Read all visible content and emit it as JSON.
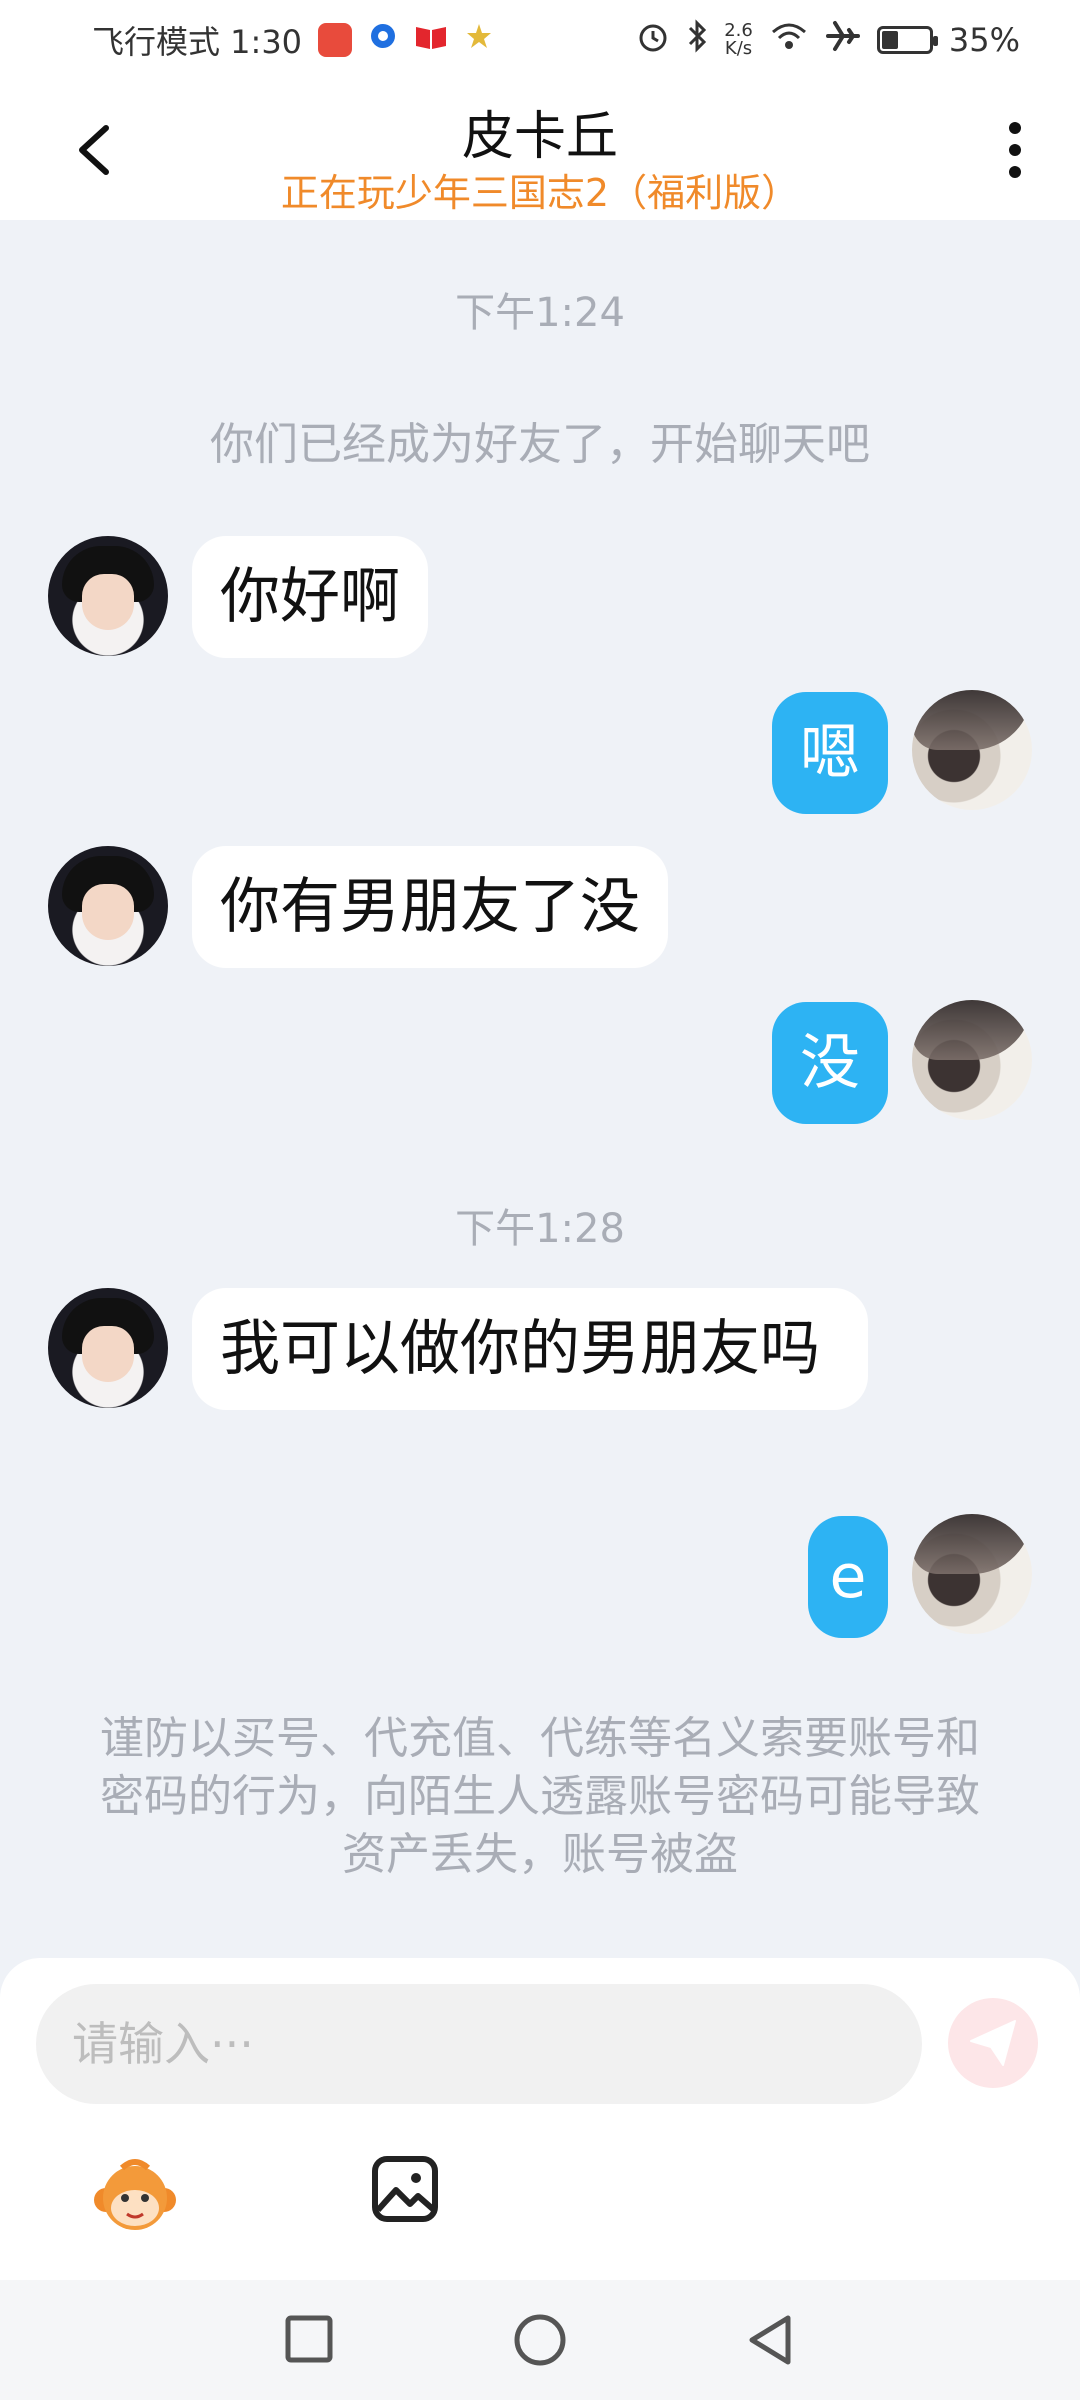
{
  "status_bar": {
    "left_text": "飞行模式 1:30",
    "speed_value": "2.6",
    "speed_unit": "K/s",
    "battery_text": "35%",
    "battery_level": 0.35
  },
  "header": {
    "title": "皮卡丘",
    "subtitle": "正在玩少年三国志2（福利版）"
  },
  "chat": {
    "timestamps": [
      "下午1:24",
      "下午1:28"
    ],
    "system_message": "你们已经成为好友了，开始聊天吧",
    "messages": [
      {
        "from": "friend",
        "text": "你好啊"
      },
      {
        "from": "me",
        "text": "嗯"
      },
      {
        "from": "friend",
        "text": "你有男朋友了没"
      },
      {
        "from": "me",
        "text": "没"
      },
      {
        "from": "friend",
        "text": "我可以做你的男朋友吗"
      },
      {
        "from": "me",
        "text": "e"
      }
    ],
    "notice": "谨防以买号、代充值、代练等名义索要账号和密码的行为，向陌生人透露账号密码可能导致资产丢失，账号被盗"
  },
  "input": {
    "placeholder": "请输入···"
  },
  "colors": {
    "accent_orange": "#f08a2a",
    "bubble_blue": "#2db3f3",
    "background": "#eff2f7"
  }
}
